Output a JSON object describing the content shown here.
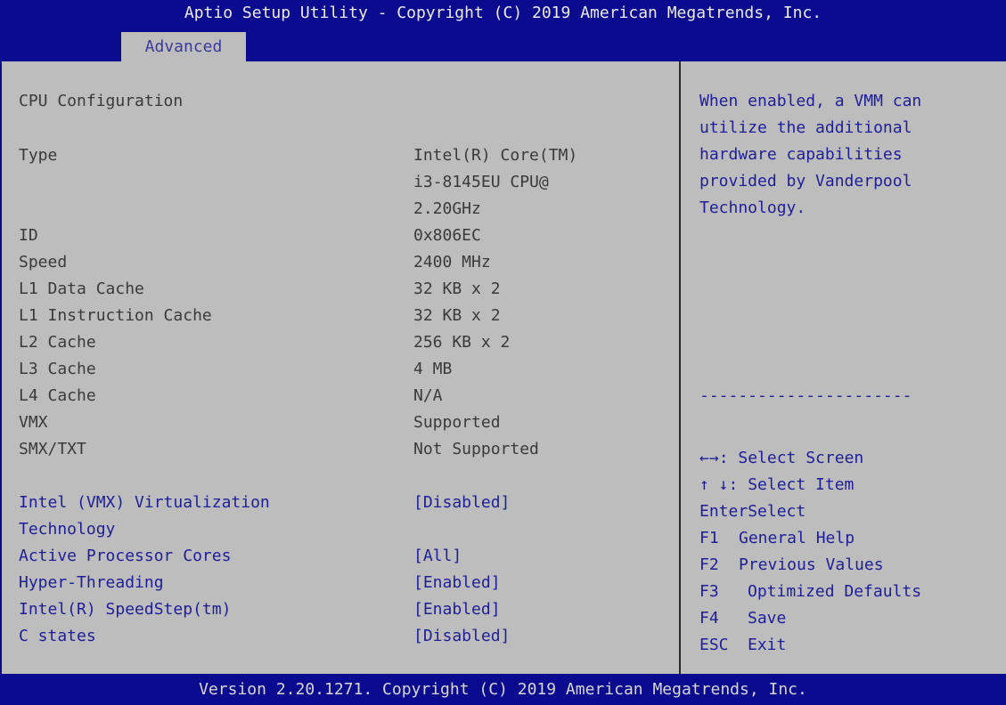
{
  "header": {
    "title": "Aptio Setup Utility - Copyright (C) 2019 American Megatrends, Inc.",
    "active_tab": "Advanced"
  },
  "main": {
    "section_title": "CPU Configuration",
    "info_rows": [
      {
        "label": "Type",
        "value_lines": [
          "Intel(R) Core(TM)",
          "i3-8145EU CPU@",
          "2.20GHz"
        ]
      },
      {
        "label": "ID",
        "value": "0x806EC"
      },
      {
        "label": "Speed",
        "value": "2400 MHz"
      },
      {
        "label": "L1 Data Cache",
        "value": "32 KB x 2"
      },
      {
        "label": "L1 Instruction Cache",
        "value": "32 KB x 2"
      },
      {
        "label": "L2 Cache",
        "value": "256 KB x 2"
      },
      {
        "label": "L3 Cache",
        "value": "4 MB"
      },
      {
        "label": "L4 Cache",
        "value": "N/A"
      },
      {
        "label": "VMX",
        "value": "Supported"
      },
      {
        "label": "SMX/TXT",
        "value": "Not Supported"
      }
    ],
    "settings": [
      {
        "label_lines": [
          "Intel (VMX) Virtualization",
          "Technology"
        ],
        "value": "[Disabled]"
      },
      {
        "label": "Active Processor Cores",
        "value": "[All]"
      },
      {
        "label": "Hyper-Threading",
        "value": "[Enabled]"
      },
      {
        "label": "Intel(R) SpeedStep(tm)",
        "value": "[Enabled]"
      },
      {
        "label": "C states",
        "value": "[Disabled]"
      }
    ]
  },
  "help": {
    "lines": [
      "When enabled, a VMM can",
      "utilize the additional",
      "hardware capabilities",
      "provided by Vanderpool",
      "Technology."
    ],
    "separator": "----------------------",
    "keys": [
      {
        "key": "←→",
        "desc": ": Select Screen"
      },
      {
        "key": "↑ ↓",
        "desc": ": Select Item"
      },
      {
        "key": "Enter",
        "desc": "Select"
      },
      {
        "key": "F1",
        "desc": "General Help"
      },
      {
        "key": "F2",
        "desc": "Previous Values"
      },
      {
        "key": "F3",
        "desc": "Optimized Defaults"
      },
      {
        "key": "F4",
        "desc": "Save"
      },
      {
        "key": "ESC",
        "desc": "Exit"
      }
    ]
  },
  "footer": {
    "text": "Version 2.20.1271. Copyright (C) 2019 American Megatrends, Inc."
  }
}
